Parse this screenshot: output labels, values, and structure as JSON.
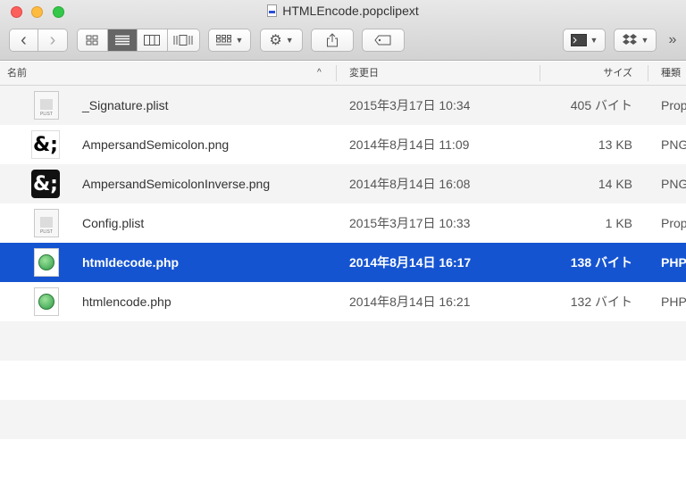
{
  "window": {
    "title": "HTMLEncode.popclipext"
  },
  "toolbar": {
    "back": "‹",
    "forward": "›",
    "more": "»"
  },
  "columns": {
    "name": "名前",
    "date": "変更日",
    "size": "サイズ",
    "kind": "種類"
  },
  "files": [
    {
      "name": "_Signature.plist",
      "date": "2015年3月17日 10:34",
      "size": "405 バイト",
      "kind": "Prop",
      "icon": "plist-file-icon",
      "icon_label": "PLIST"
    },
    {
      "name": "AmpersandSemicolon.png",
      "date": "2014年8月14日 11:09",
      "size": "13 KB",
      "kind": "PNG",
      "icon": "ampersand-image-icon",
      "icon_glyph": "&;"
    },
    {
      "name": "AmpersandSemicolonInverse.png",
      "date": "2014年8月14日 16:08",
      "size": "14 KB",
      "kind": "PNG",
      "icon": "ampersand-inverse-image-icon",
      "icon_glyph": "&;"
    },
    {
      "name": "Config.plist",
      "date": "2015年3月17日 10:33",
      "size": "1 KB",
      "kind": "Prop",
      "icon": "plist-file-icon",
      "icon_label": "PLIST"
    },
    {
      "name": "htmldecode.php",
      "date": "2014年8月14日 16:17",
      "size": "138 バイト",
      "kind": "PHP",
      "icon": "php-file-icon"
    },
    {
      "name": "htmlencode.php",
      "date": "2014年8月14日 16:21",
      "size": "132 バイト",
      "kind": "PHP",
      "icon": "php-file-icon"
    }
  ],
  "colors": {
    "selection": "#1554d1"
  }
}
